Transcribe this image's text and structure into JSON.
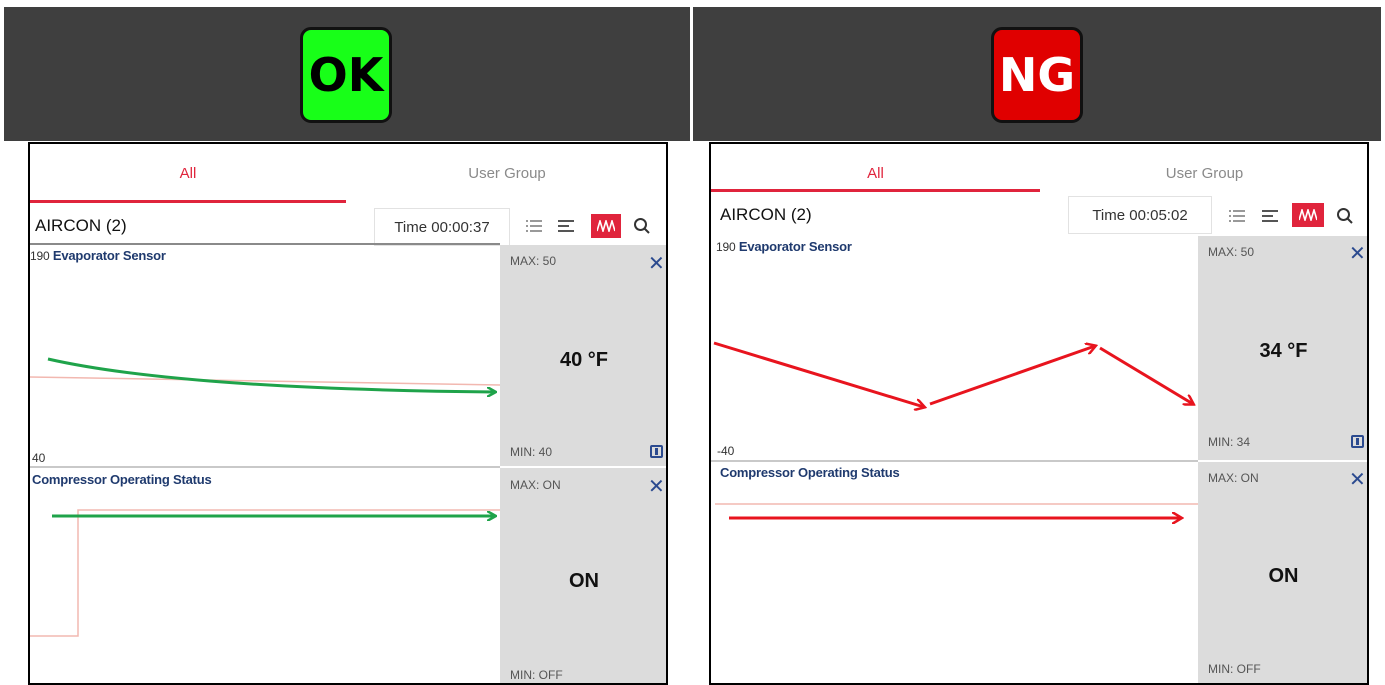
{
  "ok_panel": {
    "badge": "OK",
    "badge_color": "#18ff18",
    "tabs": [
      "All",
      "User Group"
    ],
    "device": "AIRCON (2)",
    "time": "Time 00:00:37",
    "sensors": [
      {
        "name": "Evaporator Sensor",
        "max": "MAX: 50",
        "min": "MIN: 40",
        "value": "40 °F",
        "scale_top": "190",
        "scale_bottom": "40"
      },
      {
        "name": "Compressor Operating Status",
        "max": "MAX: ON",
        "min": "MIN: OFF",
        "value": "ON"
      }
    ]
  },
  "ng_panel": {
    "badge": "NG",
    "badge_color": "#e00000",
    "tabs": [
      "All",
      "User Group"
    ],
    "device": "AIRCON (2)",
    "time": "Time 00:05:02",
    "sensors": [
      {
        "name": "Evaporator Sensor",
        "max": "MAX: 50",
        "min": "MIN: 34",
        "value": "34 °F",
        "scale_top": "190",
        "scale_bottom": "-40"
      },
      {
        "name": "Compressor Operating Status",
        "max": "MAX: ON",
        "min": "MIN: OFF",
        "value": "ON"
      }
    ]
  },
  "icons": [
    "list-icon",
    "align-icon",
    "graph-icon",
    "search-icon",
    "close-icon",
    "info-icon"
  ],
  "colors": {
    "accent": "#e0243c",
    "ok_arrow": "#1fa34a",
    "ng_arrow": "#e8141e",
    "trace": "#f2b8b0"
  }
}
